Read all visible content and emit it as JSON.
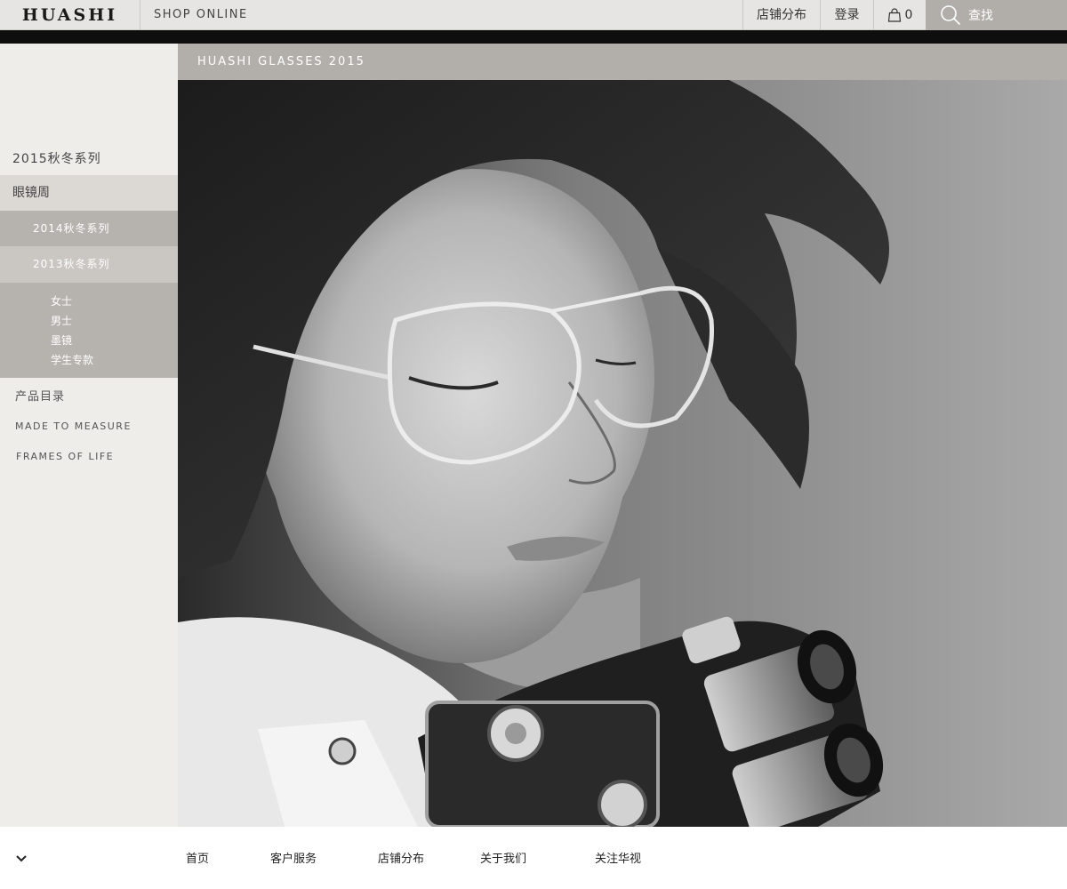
{
  "header": {
    "logo": "HUASHI",
    "shop_online": "SHOP ONLINE",
    "stores": "店铺分布",
    "login": "登录",
    "cart_count": "0",
    "search_label": "查找"
  },
  "sidebar": {
    "items": [
      {
        "label": "2015秋冬系列"
      },
      {
        "label": "眼镜周"
      },
      {
        "label": "2014秋冬系列"
      },
      {
        "label": "2013秋冬系列"
      }
    ],
    "sub_items": [
      {
        "label": "女士"
      },
      {
        "label": "男士"
      },
      {
        "label": "墨镜"
      },
      {
        "label": "学生专款"
      }
    ],
    "catalog": "产品目录",
    "made_to_measure": "MADE TO MEASURE",
    "frames_of_life": "FRAMES OF LIFE"
  },
  "hero": {
    "title": "HUASHI GLASSES 2015"
  },
  "footer": {
    "links": [
      {
        "label": "首页"
      },
      {
        "label": "客户服务"
      },
      {
        "label": "店铺分布"
      },
      {
        "label": "关于我们"
      },
      {
        "label": "关注华视"
      }
    ]
  },
  "colors": {
    "topbar_bg": "#e6e5e3",
    "search_bg": "#b1aea9",
    "sidebar_bg": "#efedea",
    "active_item_bg": "#b6b3ae",
    "hero_header_bg": "#b2afab"
  }
}
